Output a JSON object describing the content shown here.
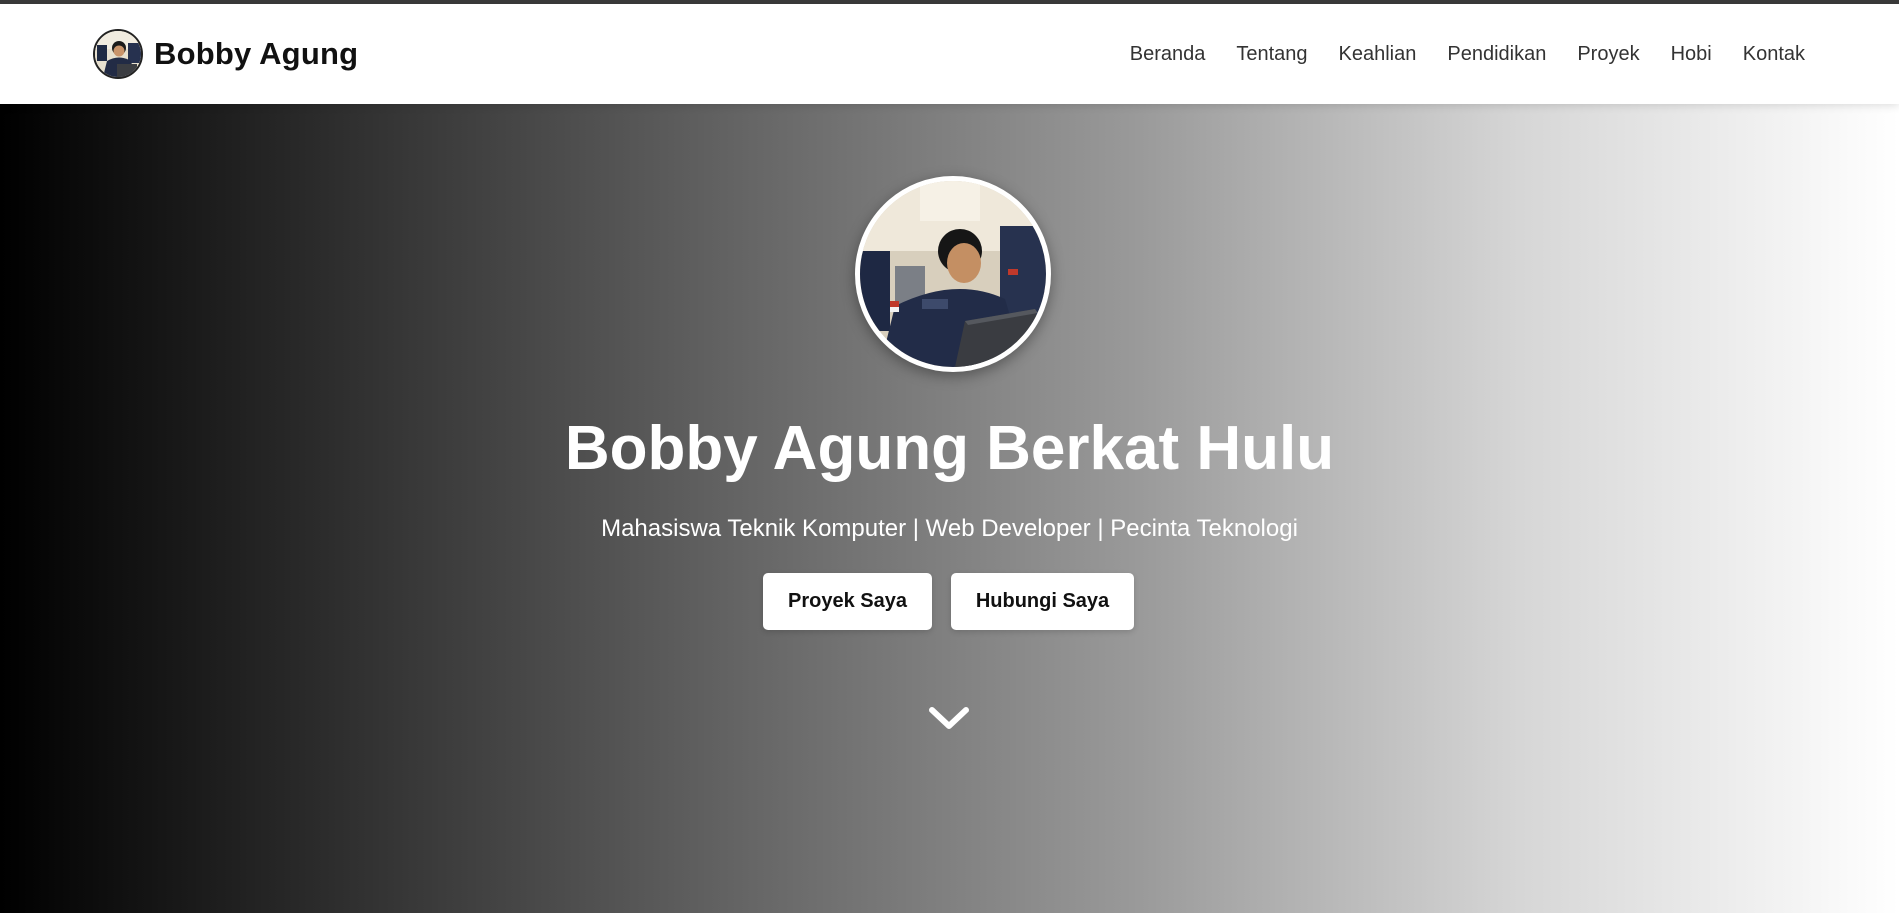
{
  "brand": {
    "name": "Bobby Agung",
    "avatar_icon": "profile-photo"
  },
  "nav": {
    "items": [
      {
        "label": "Beranda"
      },
      {
        "label": "Tentang"
      },
      {
        "label": "Keahlian"
      },
      {
        "label": "Pendidikan"
      },
      {
        "label": "Proyek"
      },
      {
        "label": "Hobi"
      },
      {
        "label": "Kontak"
      }
    ]
  },
  "hero": {
    "photo": "profile-photo",
    "title": "Bobby Agung Berkat Hulu",
    "subtitle": "Mahasiswa Teknik Komputer | Web Developer | Pecinta Teknologi",
    "buttons": {
      "projects": "Proyek Saya",
      "contact": "Hubungi Saya"
    },
    "scroll_icon": "chevron-down-icon"
  },
  "colors": {
    "gradient_start": "#000000",
    "gradient_end": "#ffffff",
    "button_bg": "#ffffff",
    "nav_text": "#333333"
  }
}
